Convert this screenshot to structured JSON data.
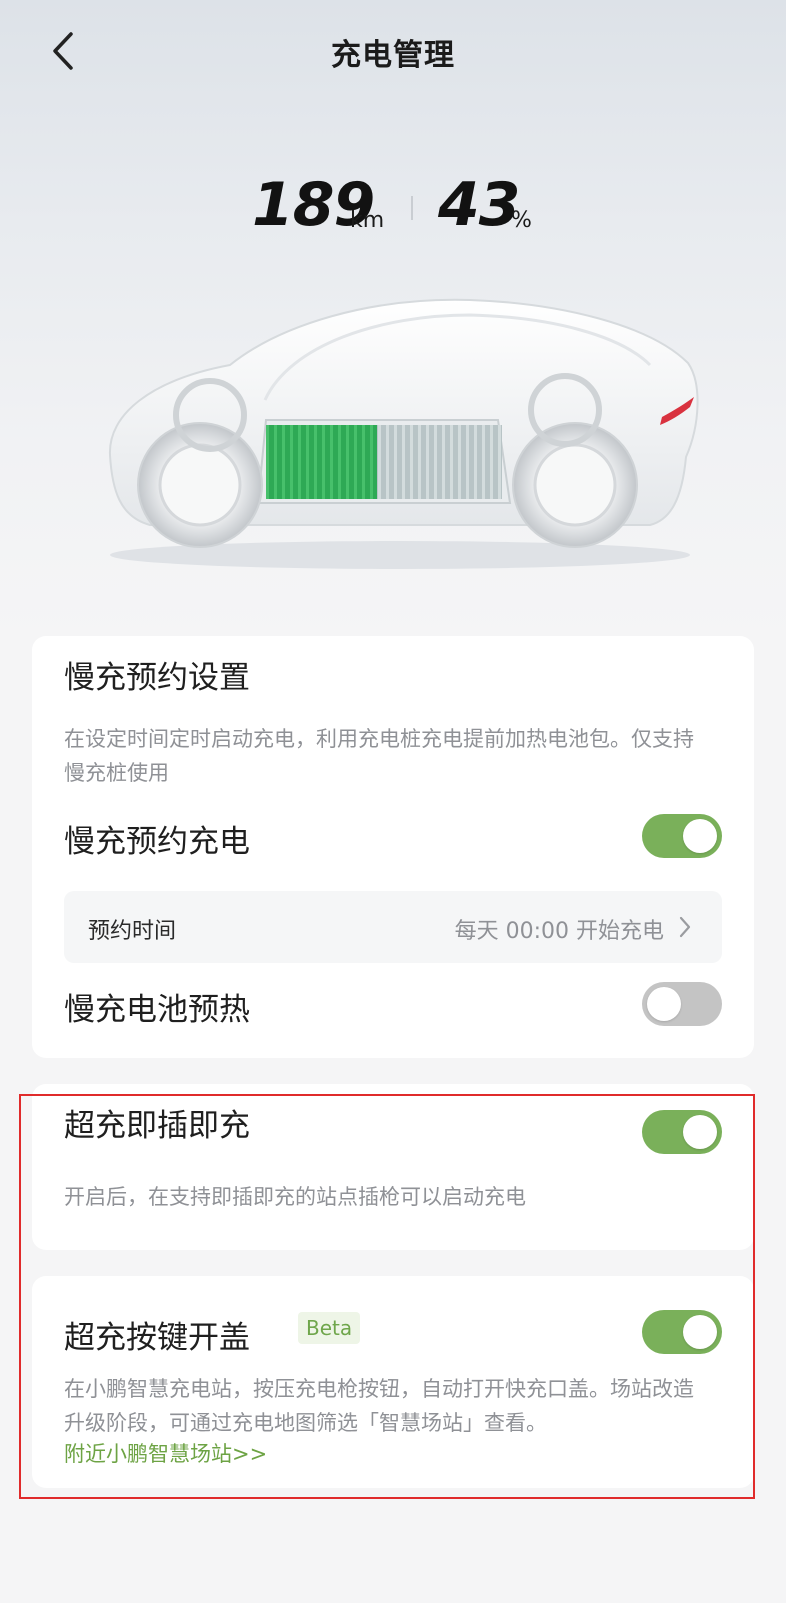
{
  "header": {
    "title": "充电管理",
    "back_icon": "chevron-left-icon"
  },
  "stats": {
    "range_value": "189",
    "range_unit": "km",
    "battery_value": "43",
    "battery_unit": "%",
    "battery_level_fraction": 0.43
  },
  "colors": {
    "accent_green": "#7ab05a",
    "toggle_off": "#c4c4c4",
    "link_green": "#6da344",
    "highlight_red": "#e02b2b"
  },
  "slow_charge_card": {
    "title": "慢充预约设置",
    "description": "在设定时间定时启动充电，利用充电桩充电提前加热电池包。仅支持慢充桩使用",
    "schedule_toggle_label": "慢充预约充电",
    "schedule_toggle_on": true,
    "schedule_row_label": "预约时间",
    "schedule_row_value": "每天 00:00 开始充电",
    "preheat_toggle_label": "慢充电池预热",
    "preheat_toggle_on": false
  },
  "plug_charge_card": {
    "title": "超充即插即充",
    "toggle_on": true,
    "description": "开启后，在支持即插即充的站点插枪可以启动充电"
  },
  "button_lid_card": {
    "title": "超充按键开盖",
    "badge": "Beta",
    "toggle_on": true,
    "description": "在小鹏智慧充电站，按压充电枪按钮，自动打开快充口盖。场站改造升级阶段，可通过充电地图筛选「智慧场站」查看。",
    "link": "附近小鹏智慧场站>>"
  }
}
